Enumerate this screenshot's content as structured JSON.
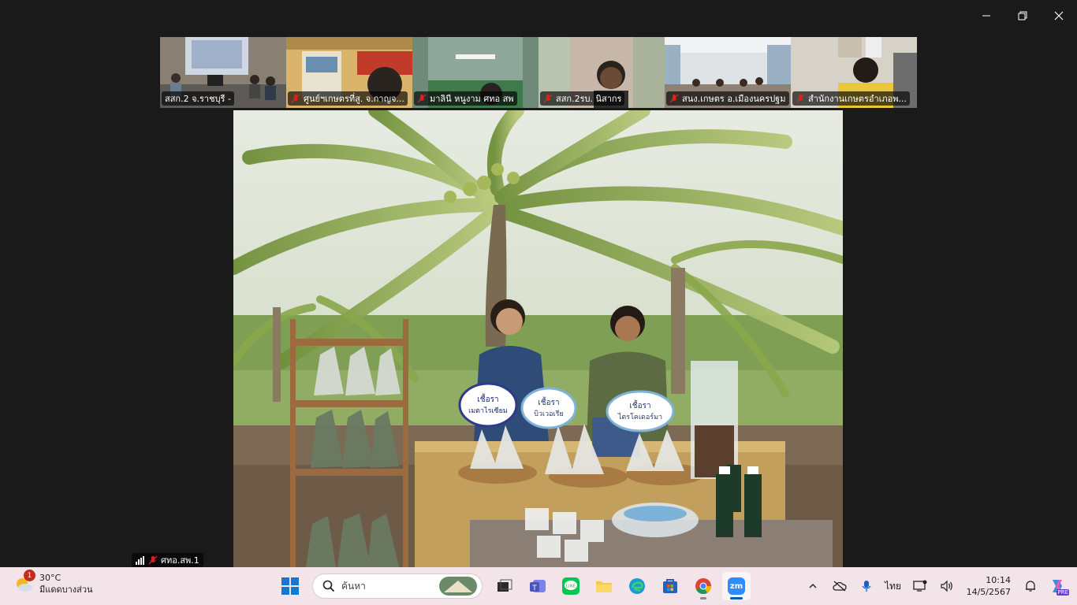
{
  "participants": [
    {
      "name": "สสก.2 จ.ราชบุรี -",
      "muted": false
    },
    {
      "name": "ศูนย์ฯเกษตรที่สู. จ.กาญจ...",
      "muted": true
    },
    {
      "name": "มาลินี หนูงาม ศทอ สพ",
      "muted": true
    },
    {
      "name": "สสก.2รบ. นิสากร",
      "muted": true
    },
    {
      "name": "สนง.เกษตร อ.เมืองนครปฐม",
      "muted": true
    },
    {
      "name": "สำนักงานเกษตรอำเภอพ...",
      "muted": true
    }
  ],
  "self_view": {
    "label": "ศทอ.สพ.1"
  },
  "stage_signs": {
    "left": [
      "เชื้อรา",
      "เมตาไรเซียม"
    ],
    "middle": [
      "เชื้อรา",
      "บิวเวอเรีย"
    ],
    "right": [
      "เชื้อรา",
      "ไตรโคเดอร์มา"
    ]
  },
  "taskbar": {
    "weather": {
      "temp": "30°C",
      "desc": "มีแดดบางส่วน",
      "badge": "1"
    },
    "search_placeholder": "ค้นหา",
    "lang": "ไทย",
    "time": "10:14",
    "date": "14/5/2567",
    "apps": [
      "start-icon",
      "task-view-icon",
      "teams-icon",
      "line-icon",
      "file-explorer-icon",
      "edge-icon",
      "store-icon",
      "chrome-icon",
      "zoom-icon"
    ],
    "zoom_label": "zm",
    "copilot_badge": "PRE"
  },
  "colors": {
    "taskbar_bg": "#f3e4ea",
    "accent": "#005fb8",
    "mute_red": "#e02020"
  }
}
